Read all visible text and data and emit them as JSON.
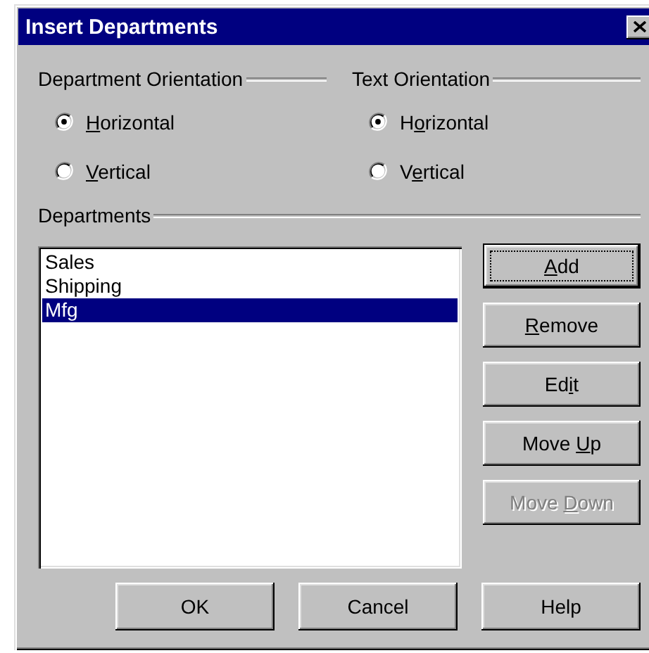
{
  "window": {
    "title": "Insert Departments"
  },
  "department_orientation": {
    "label": "Department Orientation",
    "options": [
      {
        "label": {
          "key": "H",
          "post": "orizontal"
        },
        "selected": true
      },
      {
        "label": {
          "key": "V",
          "post": "ertical"
        },
        "selected": false
      }
    ]
  },
  "text_orientation": {
    "label": "Text Orientation",
    "options": [
      {
        "label": {
          "pre": "H",
          "key": "o",
          "post": "rizontal"
        },
        "selected": true
      },
      {
        "label": {
          "pre": "V",
          "key": "e",
          "post": "rtical"
        },
        "selected": false
      }
    ]
  },
  "departments": {
    "label": "Departments",
    "items": [
      {
        "label": "Sales",
        "selected": false
      },
      {
        "label": "Shipping",
        "selected": false
      },
      {
        "label": "Mfg",
        "selected": true
      }
    ]
  },
  "side_buttons": [
    {
      "label": {
        "key": "A",
        "post": "dd"
      },
      "default": true,
      "disabled": false
    },
    {
      "label": {
        "key": "R",
        "post": "emove"
      },
      "default": false,
      "disabled": false
    },
    {
      "label": {
        "pre": "Ed",
        "key": "i",
        "post": "t"
      },
      "default": false,
      "disabled": false
    },
    {
      "label": {
        "pre": "Move ",
        "key": "U",
        "post": "p"
      },
      "default": false,
      "disabled": false
    },
    {
      "label": {
        "pre": "Move ",
        "key": "D",
        "post": "own"
      },
      "default": false,
      "disabled": true
    }
  ],
  "bottom_buttons": [
    {
      "label": "OK"
    },
    {
      "label": "Cancel"
    },
    {
      "label": "Help"
    }
  ]
}
